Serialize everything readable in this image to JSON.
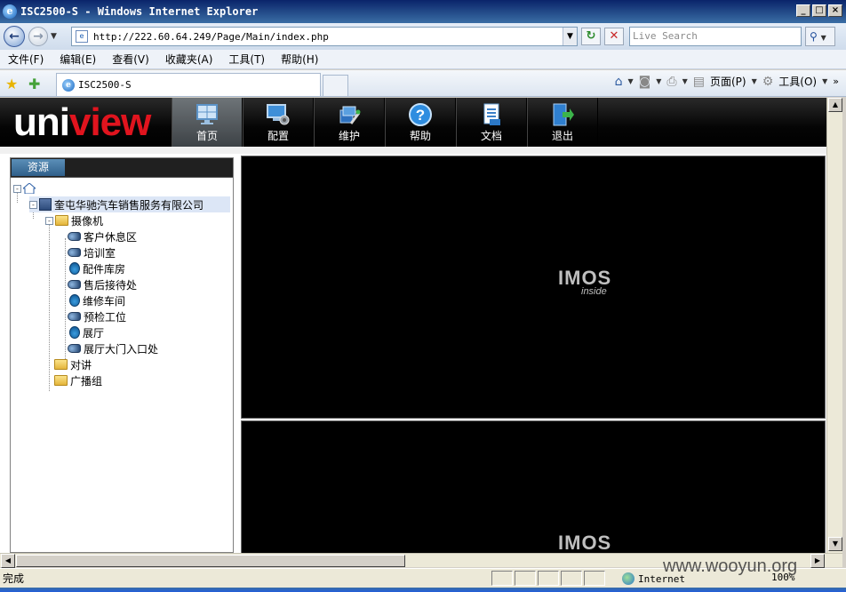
{
  "window": {
    "title": "ISC2500-S - Windows Internet Explorer",
    "min": "_",
    "max": "□",
    "close": "×"
  },
  "address": {
    "url": "http://222.60.64.249/Page/Main/index.php",
    "search_placeholder": "Live Search"
  },
  "menu": [
    "文件(F)",
    "编辑(E)",
    "查看(V)",
    "收藏夹(A)",
    "工具(T)",
    "帮助(H)"
  ],
  "tab": {
    "label": "ISC2500-S"
  },
  "commandbar": {
    "page": "页面(P)",
    "tools": "工具(O)"
  },
  "app": {
    "logo_uni": "uni",
    "logo_view": "view",
    "nav": [
      "首页",
      "配置",
      "维护",
      "帮助",
      "文档",
      "退出"
    ],
    "active_nav": "首页",
    "panel_title": "资源",
    "tree": {
      "org": "奎屯华驰汽车销售服务有限公司",
      "cameras_group": "摄像机",
      "cameras": [
        "客户休息区",
        "培训室",
        "配件库房",
        "售后接待处",
        "维修车间",
        "预检工位",
        "展厅",
        "展厅大门入口处"
      ],
      "intercom": "对讲",
      "broadcast": "广播组"
    },
    "video_brand": "IMOS",
    "video_brand_sub": "inside"
  },
  "status": {
    "text": "完成",
    "zone": "Internet",
    "zoom": "100%"
  },
  "watermark": "www.wooyun.org",
  "colors": {
    "logo_red": "#e0141e",
    "title_bar": "#0a246a",
    "panel_tab": "#3a6e9a"
  }
}
